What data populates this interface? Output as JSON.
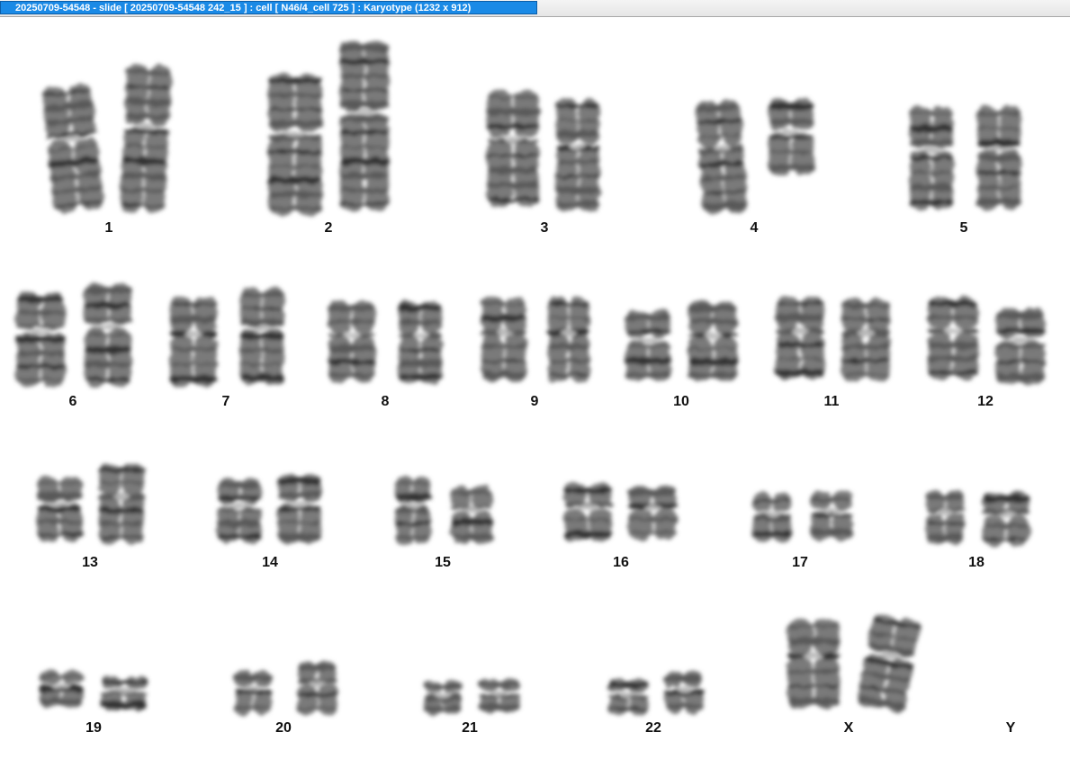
{
  "window": {
    "title": "20250709-54548 - slide [ 20250709-54548 242_15 ] : cell [ N46/4_cell 725 ] : Karyotype  (1232 x 912)"
  },
  "karyotype": {
    "chromosomes": [
      {
        "label": "1",
        "count": 2
      },
      {
        "label": "2",
        "count": 2
      },
      {
        "label": "3",
        "count": 2
      },
      {
        "label": "4",
        "count": 2
      },
      {
        "label": "5",
        "count": 2
      },
      {
        "label": "6",
        "count": 2
      },
      {
        "label": "7",
        "count": 2
      },
      {
        "label": "8",
        "count": 2
      },
      {
        "label": "9",
        "count": 2
      },
      {
        "label": "10",
        "count": 2
      },
      {
        "label": "11",
        "count": 2
      },
      {
        "label": "12",
        "count": 2
      },
      {
        "label": "13",
        "count": 2
      },
      {
        "label": "14",
        "count": 2
      },
      {
        "label": "15",
        "count": 2
      },
      {
        "label": "16",
        "count": 2
      },
      {
        "label": "17",
        "count": 2
      },
      {
        "label": "18",
        "count": 2
      },
      {
        "label": "19",
        "count": 2
      },
      {
        "label": "20",
        "count": 2
      },
      {
        "label": "21",
        "count": 2
      },
      {
        "label": "22",
        "count": 2
      },
      {
        "label": "X",
        "count": 2
      },
      {
        "label": "Y",
        "count": 0
      }
    ]
  }
}
